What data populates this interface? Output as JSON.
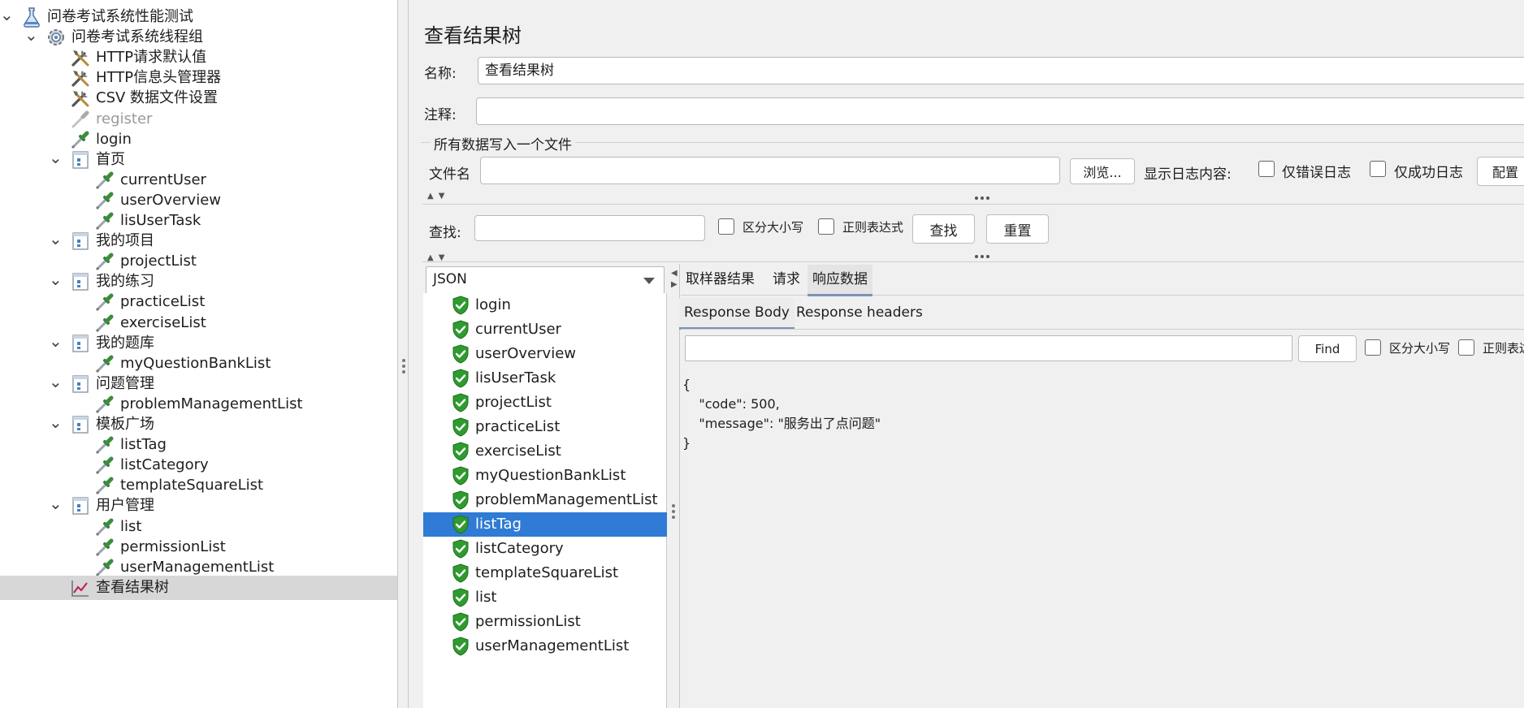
{
  "tree": {
    "items": [
      {
        "label": "问卷考试系统性能测试",
        "icon": "flask-icon",
        "level": 0,
        "toggle": "expanded"
      },
      {
        "label": "问卷考试系统线程组",
        "icon": "gear-icon",
        "level": 1,
        "toggle": "expanded"
      },
      {
        "label": "HTTP请求默认值",
        "icon": "wrench-icon",
        "level": 2
      },
      {
        "label": "HTTP信息头管理器",
        "icon": "wrench-icon",
        "level": 2
      },
      {
        "label": "CSV 数据文件设置",
        "icon": "wrench-icon",
        "level": 2
      },
      {
        "label": "register",
        "icon": "pipette-icon",
        "level": 2,
        "disabled": true
      },
      {
        "label": "login",
        "icon": "pipette-icon",
        "level": 2
      },
      {
        "label": "首页",
        "icon": "controller-icon",
        "level": 2,
        "toggle": "expanded"
      },
      {
        "label": "currentUser",
        "icon": "pipette-icon",
        "level": 3
      },
      {
        "label": "userOverview",
        "icon": "pipette-icon",
        "level": 3
      },
      {
        "label": "lisUserTask",
        "icon": "pipette-icon",
        "level": 3
      },
      {
        "label": "我的项目",
        "icon": "controller-icon",
        "level": 2,
        "toggle": "expanded"
      },
      {
        "label": "projectList",
        "icon": "pipette-icon",
        "level": 3
      },
      {
        "label": "我的练习",
        "icon": "controller-icon",
        "level": 2,
        "toggle": "expanded"
      },
      {
        "label": "practiceList",
        "icon": "pipette-icon",
        "level": 3
      },
      {
        "label": "exerciseList",
        "icon": "pipette-icon",
        "level": 3
      },
      {
        "label": "我的题库",
        "icon": "controller-icon",
        "level": 2,
        "toggle": "expanded"
      },
      {
        "label": " myQuestionBankList",
        "icon": "pipette-icon",
        "level": 3
      },
      {
        "label": "问题管理",
        "icon": "controller-icon",
        "level": 2,
        "toggle": "expanded"
      },
      {
        "label": "problemManagementList",
        "icon": "pipette-icon",
        "level": 3
      },
      {
        "label": "模板广场",
        "icon": "controller-icon",
        "level": 2,
        "toggle": "expanded"
      },
      {
        "label": "listTag",
        "icon": "pipette-icon",
        "level": 3
      },
      {
        "label": "listCategory",
        "icon": "pipette-icon",
        "level": 3
      },
      {
        "label": "templateSquareList",
        "icon": "pipette-icon",
        "level": 3
      },
      {
        "label": "用户管理",
        "icon": "controller-icon",
        "level": 2,
        "toggle": "expanded"
      },
      {
        "label": "list",
        "icon": "pipette-icon",
        "level": 3
      },
      {
        "label": "permissionList",
        "icon": "pipette-icon",
        "level": 3
      },
      {
        "label": "userManagementList",
        "icon": "pipette-icon",
        "level": 3
      },
      {
        "label": "查看结果树",
        "icon": "graph-icon",
        "level": 2,
        "selected": true
      }
    ]
  },
  "panel": {
    "title": "查看结果树",
    "name_label": "名称:",
    "name_value": "查看结果树",
    "comment_label": "注释:",
    "comment_value": "",
    "file_section_title": "所有数据写入一个文件",
    "filename_label": "文件名",
    "filename_value": "",
    "browse_button": "浏览...",
    "log_label": "显示日志内容:",
    "errors_only_label": "仅错误日志",
    "success_only_label": "仅成功日志",
    "configure_button": "配置",
    "search_label": "查找:",
    "search_value": "",
    "case_sensitive_label": "区分大小写",
    "regex_label": "正则表达式",
    "find_button": "查找",
    "reset_button": "重置",
    "renderer_selected": "JSON"
  },
  "results": {
    "items": [
      {
        "label": "login"
      },
      {
        "label": "currentUser"
      },
      {
        "label": "userOverview"
      },
      {
        "label": "lisUserTask"
      },
      {
        "label": "projectList"
      },
      {
        "label": "practiceList"
      },
      {
        "label": "exerciseList"
      },
      {
        "label": " myQuestionBankList"
      },
      {
        "label": "problemManagementList"
      },
      {
        "label": "listTag",
        "selected": true
      },
      {
        "label": "listCategory"
      },
      {
        "label": "templateSquareList"
      },
      {
        "label": "list"
      },
      {
        "label": "permissionList"
      },
      {
        "label": "userManagementList"
      }
    ],
    "status_icon": "success-shield-icon"
  },
  "detail": {
    "tabs": [
      "取样器结果",
      "请求",
      "响应数据"
    ],
    "active_tab": "响应数据",
    "subtabs": [
      "Response Body",
      "Response headers"
    ],
    "active_subtab": "Response Body",
    "find_value": "",
    "find_button": "Find",
    "case_sensitive_label": "区分大小写",
    "regex_label": "正则表达",
    "body_lines": [
      "{",
      "    \"code\": 500,",
      "    \"message\": \"服务出了点问题\"",
      "}"
    ]
  },
  "colors": {
    "selection": "#2f7bd5",
    "success": "#2e9b2e",
    "tree_selected": "#d7d7d7"
  }
}
